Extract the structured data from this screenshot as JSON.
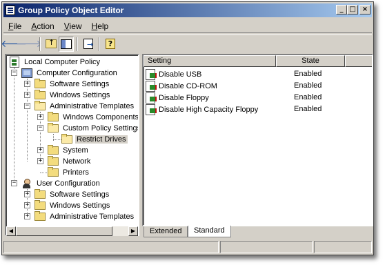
{
  "window": {
    "title": "Group Policy Object Editor",
    "buttons": {
      "minimize": "_",
      "maximize": "□",
      "close": "×"
    }
  },
  "menu": [
    {
      "label": "File",
      "underline": "F"
    },
    {
      "label": "Action",
      "underline": "A"
    },
    {
      "label": "View",
      "underline": "V"
    },
    {
      "label": "Help",
      "underline": "H"
    }
  ],
  "toolbar": {
    "back": "🡐",
    "forward": "🡒",
    "icons": [
      "back-arrow-icon",
      "forward-arrow-icon",
      "up-folder-icon",
      "show-hide-tree-icon",
      "export-list-icon",
      "help-icon"
    ]
  },
  "tree": {
    "root": "Local Computer Policy",
    "items": [
      "Computer Configuration",
      "Software Settings",
      "Windows Settings",
      "Administrative Templates",
      "Windows Components",
      "Custom Policy Settings",
      "Restrict Drives",
      "System",
      "Network",
      "Printers",
      "User Configuration",
      "Software Settings",
      "Windows Settings",
      "Administrative Templates"
    ],
    "selected": "Restrict Drives"
  },
  "list": {
    "columns": {
      "setting": "Setting",
      "state": "State"
    },
    "rows": [
      {
        "setting": "Disable USB",
        "state": "Enabled"
      },
      {
        "setting": "Disable CD-ROM",
        "state": "Enabled"
      },
      {
        "setting": "Disable Floppy",
        "state": "Enabled"
      },
      {
        "setting": "Disable High Capacity Floppy",
        "state": "Enabled"
      }
    ]
  },
  "tabs": {
    "extended": "Extended",
    "standard": "Standard",
    "active": "Standard"
  },
  "colors": {
    "title_start": "#0a246a",
    "title_end": "#a6caf0",
    "face": "#d4d0c8"
  }
}
